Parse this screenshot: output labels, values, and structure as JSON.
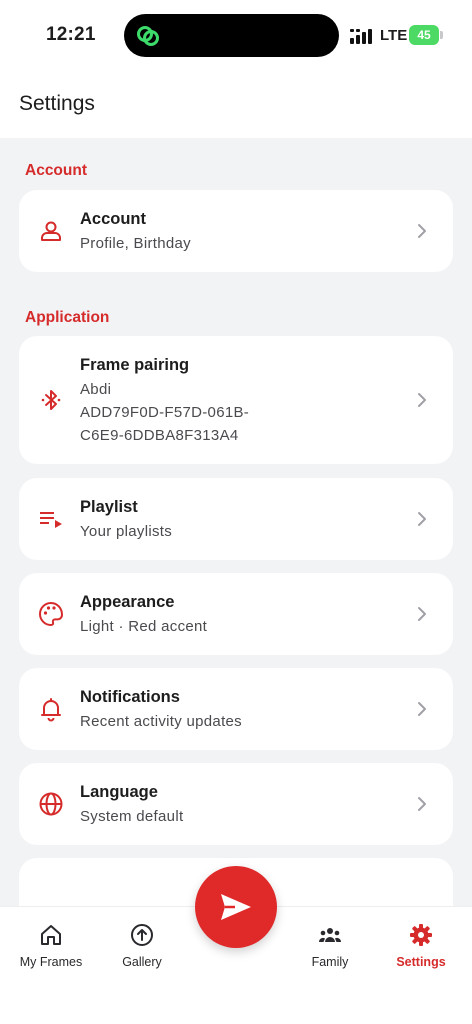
{
  "status_bar": {
    "time": "12:21",
    "network": "LTE",
    "battery": "45"
  },
  "header": {
    "title": "Settings"
  },
  "sections": [
    {
      "label": "Account"
    },
    {
      "label": "Application"
    }
  ],
  "rows": {
    "account": {
      "title": "Account",
      "subtitle": "Profile, Birthday",
      "icon": "person-icon"
    },
    "frame_pairing": {
      "title": "Frame pairing",
      "subtitle_line1": "Abdi",
      "subtitle_line2": "ADD79F0D-F57D-061B-",
      "subtitle_line3": "C6E9-6DDBA8F313A4",
      "icon": "bluetooth-icon"
    },
    "playlist": {
      "title": "Playlist",
      "subtitle": "Your playlists",
      "icon": "playlist-icon"
    },
    "appearance": {
      "title": "Appearance",
      "subtitle": "Light · Red accent",
      "icon": "palette-icon"
    },
    "notifications": {
      "title": "Notifications",
      "subtitle": "Recent activity updates",
      "icon": "bell-icon"
    },
    "language": {
      "title": "Language",
      "subtitle": "System default",
      "icon": "globe-icon"
    }
  },
  "nav": {
    "my_frames": "My Frames",
    "gallery": "Gallery",
    "family": "Family",
    "settings": "Settings"
  },
  "colors": {
    "accent": "#d62b2b",
    "background": "#f2f3f5",
    "fab": "#e02a2a"
  }
}
